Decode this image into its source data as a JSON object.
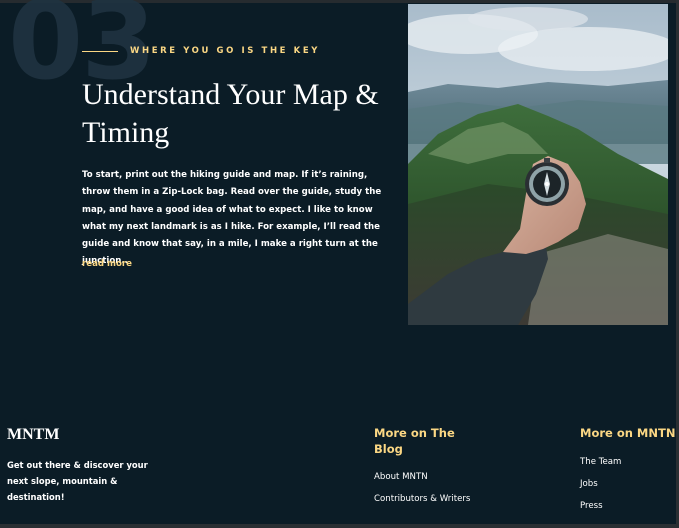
{
  "section": {
    "number": "03",
    "eyebrow": "WHERE YOU GO IS THE KEY",
    "headline": "Understand Your Map & Timing",
    "body": "To start, print out the hiking guide and map. If it’s raining, throw them in a Zip-Lock bag. Read over the guide, study the map, and have a good idea of what to expect. I like to know what my next landmark is as I hike. For example, I’ll read the guide and know that say, in a mile, I make a right turn at the junction..",
    "read_more": "read more",
    "accent_color": "#fbd784"
  },
  "footer": {
    "brand": "MNTM",
    "tagline": "Get out there & discover your next slope, mountain & destination!",
    "columns": [
      {
        "title": "More on The Blog",
        "links": [
          "About MNTN",
          "Contributors & Writers"
        ]
      },
      {
        "title": "More on MNTN",
        "links": [
          "The Team",
          "Jobs",
          "Press"
        ]
      }
    ]
  }
}
